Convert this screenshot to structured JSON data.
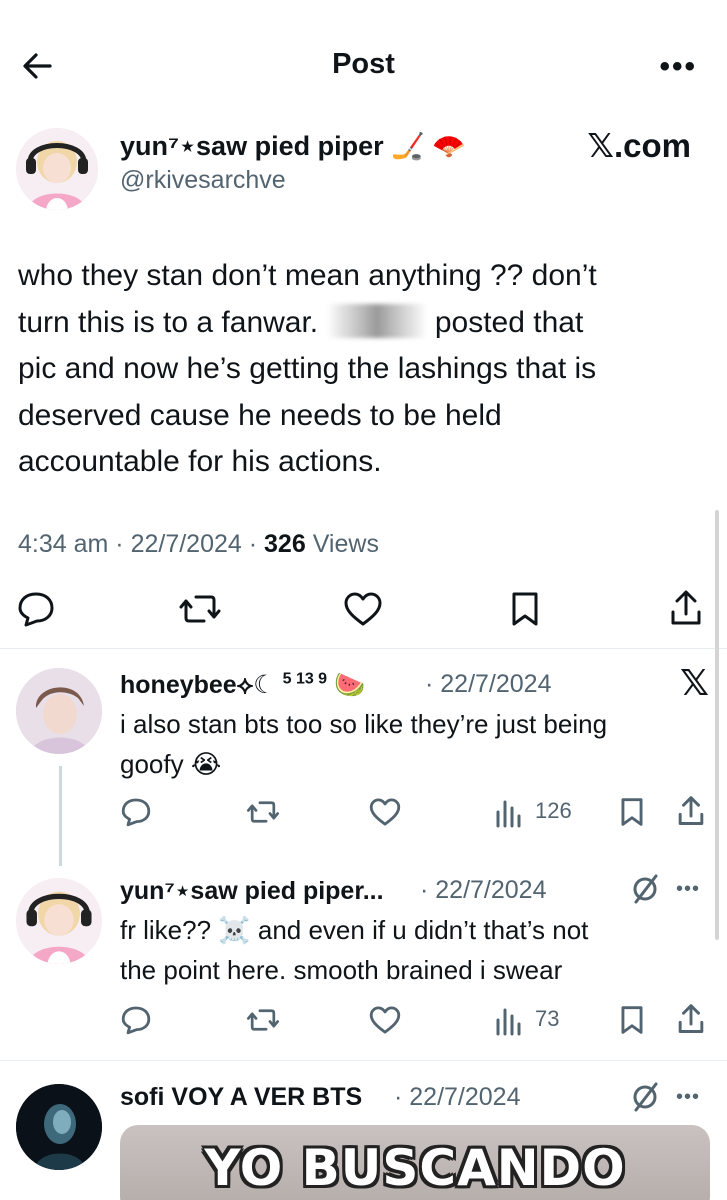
{
  "header": {
    "title": "Post",
    "back_icon": "arrow-left-icon",
    "more_icon": "more-horizontal-icon",
    "more_label": "•••"
  },
  "post": {
    "author": {
      "name": "yun⁷⋆saw pied piper",
      "name_emojis": "🏒 🪭",
      "handle": "@rkivesarchve"
    },
    "watermark": "𝕏.com",
    "text": {
      "line1": "who they stan don’t mean anything ?? don’t",
      "line2a": "turn this is to a fanwar.",
      "line2b": "posted that",
      "line3": "pic and now he’s getting the lashings that is",
      "line4": "deserved cause he needs to be held",
      "line5": "accountable for his actions."
    },
    "time": "4:34 am",
    "date": "22/7/2024",
    "views_count": "326",
    "views_label": "Views",
    "separator": "·"
  },
  "replies": [
    {
      "name": "honeybee",
      "name_suffix": "⟡☾",
      "superscript": "5 13 9",
      "name_emoji": "🍉",
      "date": "· 22/7/2024",
      "badge": "𝕏",
      "text_line1": "i also stan bts too so like they’re just being",
      "text_line2": "goofy 😭",
      "views": "126"
    },
    {
      "name": "yun⁷⋆saw pied piper...",
      "date": "· 22/7/2024",
      "text_line1": "fr like?? ☠️ and even if u didn’t that’s not",
      "text_line2": "the point here. smooth brained i swear",
      "views": "73",
      "more": "•••"
    },
    {
      "name": "sofi VOY A VER BTS",
      "date": "· 22/7/2024",
      "more": "•••",
      "meme_text": "YO BUSCANDO"
    }
  ],
  "colors": {
    "text": "#0f1419",
    "secondary": "#536471",
    "divider": "#e6ecf0"
  }
}
